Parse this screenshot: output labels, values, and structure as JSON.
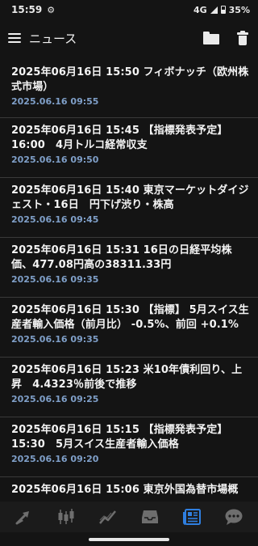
{
  "status_bar": {
    "time": "15:59",
    "network": "4G",
    "battery": "35%"
  },
  "app_bar": {
    "title": "ニュース"
  },
  "news": [
    {
      "headline": "2025年06月16日 15:50 フィボナッチ（欧州株式市場）",
      "time": "2025.06.16 09:55"
    },
    {
      "headline": "2025年06月16日 15:45 【指標発表予定】 16:00　4月トルコ経常収支",
      "time": "2025.06.16 09:50"
    },
    {
      "headline": "2025年06月16日 15:40 東京マーケットダイジェスト・16日　円下げ渋り・株高",
      "time": "2025.06.16 09:45"
    },
    {
      "headline": "2025年06月16日 15:31 16日の日経平均株価、477.08円高の38311.33円",
      "time": "2025.06.16 09:35"
    },
    {
      "headline": "2025年06月16日 15:30 【指標】 5月スイス生産者輸入価格（前月比） -0.5%、前回 +0.1%",
      "time": "2025.06.16 09:35"
    },
    {
      "headline": "2025年06月16日 15:23 米10年債利回り、上昇　4.4323％前後で推移",
      "time": "2025.06.16 09:25"
    },
    {
      "headline": "2025年06月16日 15:15 【指標発表予定】 15:30　5月スイス生産者輸入価格",
      "time": "2025.06.16 09:20"
    },
    {
      "headline": "2025年06月16日 15:06 東京外国為替市場概",
      "time": ""
    }
  ],
  "colors": {
    "background": "#141414",
    "timestamp": "#7f9fc8",
    "active_nav": "#2f7fe0",
    "inactive_nav": "#6e6e6e"
  },
  "bottom_nav": [
    {
      "icon": "rate-arrows-icon",
      "active": false
    },
    {
      "icon": "candlestick-chart-icon",
      "active": false
    },
    {
      "icon": "line-chart-icon",
      "active": false
    },
    {
      "icon": "inbox-icon",
      "active": false
    },
    {
      "icon": "newspaper-icon",
      "active": true
    },
    {
      "icon": "chat-bubble-icon",
      "active": false
    }
  ]
}
